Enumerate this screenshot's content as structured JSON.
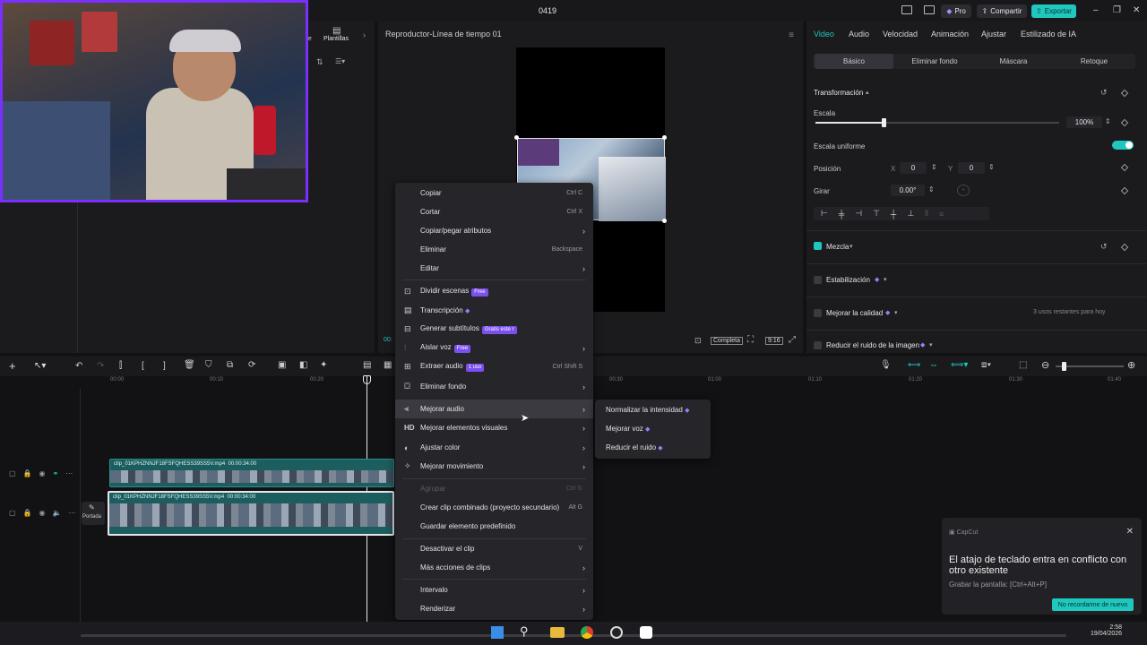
{
  "app": {
    "title": "0419",
    "pro_label": "Pro",
    "share_label": "Compartir",
    "export_label": "Exportar"
  },
  "left_panel": {
    "plantillas_label": "Plantillas",
    "partial_tab": "ate"
  },
  "player": {
    "title": "Reproductor-Línea de tiempo 01",
    "completa_label": "Completa",
    "ratio_label": "9:16",
    "time_partial": "00:"
  },
  "right_panel": {
    "tabs": [
      "Video",
      "Audio",
      "Velocidad",
      "Animación",
      "Ajustar",
      "Estilizado de IA"
    ],
    "subtabs": [
      "Básico",
      "Eliminar fondo",
      "Máscara",
      "Retoque"
    ],
    "transform_label": "Transformación",
    "scale_label": "Escala",
    "scale_value": "100%",
    "scale_fraction": 0.28,
    "uniform_scale_label": "Escala uniforme",
    "position_label": "Posición",
    "pos_x_label": "X",
    "pos_x": "0",
    "pos_y_label": "Y",
    "pos_y": "0",
    "rotate_label": "Girar",
    "rotate_value": "0.00°",
    "rotate_dash": "-",
    "blend_label": "Mezcla",
    "stabilization_label": "Estabilización",
    "improve_quality_label": "Mejorar la calidad",
    "uses_left": "3 usos restantes para hoy",
    "reduce_noise_label": "Reducir el ruido de la imagen"
  },
  "timeline": {
    "ruler": [
      "00:00",
      "00:10",
      "00:20",
      "00:30",
      "01:00",
      "01:10",
      "01:20",
      "01:30",
      "01:40"
    ],
    "clip_name": "clip_01KPHZNNJF18FSFQHESS39SS5V.mp4",
    "clip_duration": "00:00:34:00",
    "cover_label": "Portada"
  },
  "context_menu": {
    "items": [
      {
        "label": "Copiar",
        "shortcut": "Ctrl C"
      },
      {
        "label": "Cortar",
        "shortcut": "Ctrl X"
      },
      {
        "label": "Copiar/pegar atributos",
        "arrow": "›"
      },
      {
        "label": "Eliminar",
        "shortcut": "Backspace"
      },
      {
        "label": "Editar",
        "arrow": "›"
      },
      {
        "label": "Dividir escenas",
        "badge": "Free"
      },
      {
        "label": "Transcripción"
      },
      {
        "label": "Generar subtítulos",
        "badge": "Gratis este r"
      },
      {
        "label": "Aislar voz",
        "badge": "Free",
        "arrow": "›"
      },
      {
        "label": "Extraer audio",
        "badge": "1 uso",
        "shortcut": "Ctrl Shift S"
      },
      {
        "label": "Eliminar fondo",
        "arrow": "›"
      },
      {
        "label": "Mejorar audio",
        "arrow": "›"
      },
      {
        "label": "Mejorar elementos visuales",
        "arrow": "›"
      },
      {
        "label": "Ajustar color",
        "arrow": "›"
      },
      {
        "label": "Mejorar movimiento",
        "arrow": "›"
      },
      {
        "label": "Agrupar",
        "shortcut": "Ctrl G"
      },
      {
        "label": "Crear clip combinado (proyecto secundario)",
        "shortcut": "Alt G"
      },
      {
        "label": "Guardar elemento predefinido"
      },
      {
        "label": "Desactivar el clip",
        "shortcut": "V"
      },
      {
        "label": "Más acciones de clips",
        "arrow": "›"
      },
      {
        "label": "Intervalo",
        "arrow": "›"
      },
      {
        "label": "Renderizar",
        "arrow": "›"
      }
    ],
    "hd_icon": "HD"
  },
  "submenu": {
    "items": [
      "Normalizar la intensidad",
      "Mejorar voz",
      "Reducir el ruido"
    ]
  },
  "toast": {
    "app_name": "CapCut",
    "message": "El atajo de teclado entra en conflicto con otro existente",
    "detail": "Grabar la pantalla: [Ctrl+Alt+P]",
    "dismiss_label": "No recordarme de nuevo"
  },
  "taskbar": {
    "time": "2:58",
    "date": "19/04/2026"
  },
  "colors": {
    "accent": "#1fc7bf",
    "premium": "#7b4ff0",
    "webcam_border": "#7b2fff"
  }
}
